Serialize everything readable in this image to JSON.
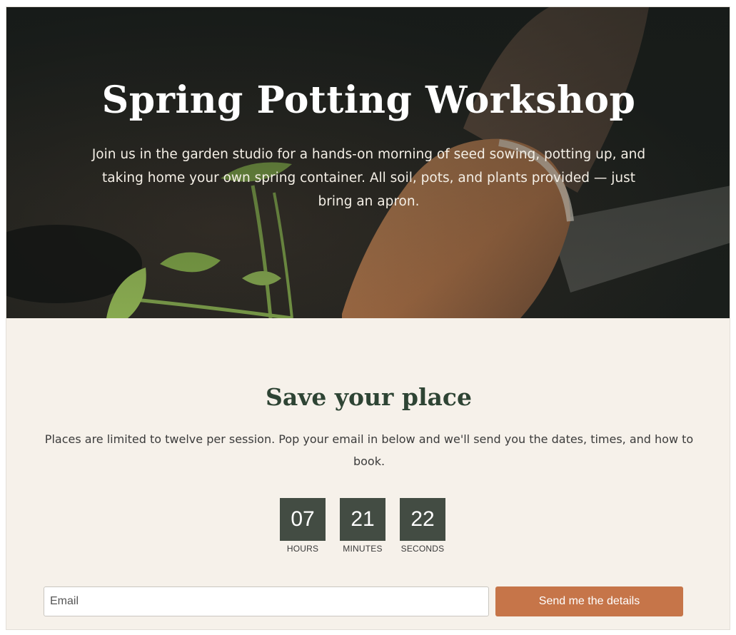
{
  "hero": {
    "title": "Spring Potting Workshop",
    "description": "Join us in the garden studio for a hands-on morning of seed sowing, potting up, and taking home your own spring container. All soil, pots, and plants provided — just bring an apron."
  },
  "signup": {
    "title": "Save your place",
    "description": "Places are limited to twelve per session. Pop your email in below and we'll send you the dates, times, and how to book.",
    "countdown": [
      {
        "value": "07",
        "label": "HOURS"
      },
      {
        "value": "21",
        "label": "MINUTES"
      },
      {
        "value": "22",
        "label": "SECONDS"
      }
    ],
    "email_placeholder": "Email",
    "submit_label": "Send me the details"
  },
  "colors": {
    "heading_green": "#2e4434",
    "timer_box": "#434c43",
    "button_terracotta": "#c67549",
    "section_bg": "#f6f1ea"
  }
}
